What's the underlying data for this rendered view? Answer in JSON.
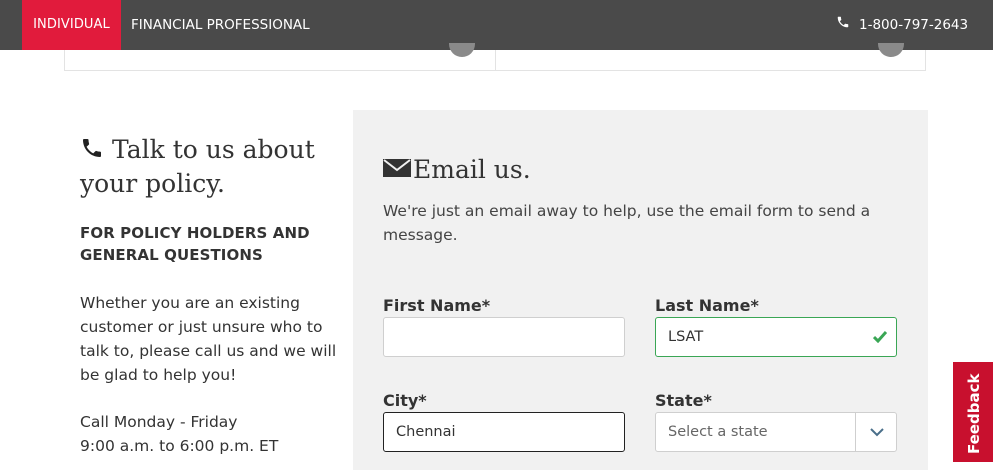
{
  "topbar": {
    "tab_individual": "INDIVIDUAL",
    "tab_financial_professional": "FINANCIAL PROFESSIONAL",
    "phone": "1-800-797-2643",
    "colors": {
      "bar": "#4a4a4a",
      "active_tab": "#e11b3c"
    }
  },
  "talk": {
    "heading": "Talk to us about your policy.",
    "subheading": "FOR POLICY HOLDERS AND GENERAL QUESTIONS",
    "body": "Whether you are an existing customer or just unsure who to talk to, please call us and we will be glad to help you!",
    "hours_line1": "Call Monday - Friday",
    "hours_line2": "9:00 a.m. to 6:00 p.m. ET"
  },
  "email": {
    "heading": "Email us.",
    "intro": "We're just an email away to help, use the email form to send a message.",
    "first_name": {
      "label": "First Name*",
      "value": ""
    },
    "last_name": {
      "label": "Last Name*",
      "value": "LSAT"
    },
    "city": {
      "label": "City*",
      "value": "Chennai"
    },
    "state": {
      "label": "State*",
      "selected": "Select a state"
    }
  },
  "feedback": {
    "label": "Feedback",
    "color": "#c8102e"
  },
  "icons": [
    "phone-icon",
    "envelope-icon",
    "checkmark-icon",
    "chevron-down-icon"
  ]
}
